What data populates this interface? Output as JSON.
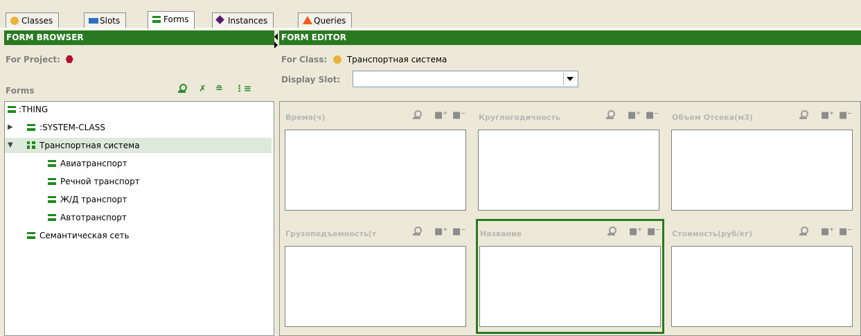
{
  "tabs": [
    {
      "label": "Classes",
      "icon": "class-icon",
      "active": false
    },
    {
      "label": "Slots",
      "icon": "slot-icon",
      "active": false
    },
    {
      "label": "Forms",
      "icon": "form-icon",
      "active": true
    },
    {
      "label": "Instances",
      "icon": "instance-icon",
      "active": false
    },
    {
      "label": "Queries",
      "icon": "query-icon",
      "active": false
    }
  ],
  "form_browser": {
    "header": "FORM BROWSER",
    "for_project_label": "For Project:",
    "forms_label": "Forms",
    "tree": [
      {
        "label": ":THING"
      },
      {
        "label": ":SYSTEM-CLASS"
      },
      {
        "label": "Транспортная система"
      },
      {
        "label": "Авиатранспорт"
      },
      {
        "label": "Речной транспорт"
      },
      {
        "label": "Ж/Д транспорт"
      },
      {
        "label": "Автотранспорт"
      },
      {
        "label": "Семантическая сеть"
      }
    ]
  },
  "form_editor": {
    "header": "FORM EDITOR",
    "for_class_label": "For Class:",
    "class_name": "Транспортная система",
    "display_slot_label": "Display Slot:",
    "display_slot_value": "",
    "widgets": [
      {
        "label": "Время(ч)"
      },
      {
        "label": "Круглогодичность"
      },
      {
        "label": "Объем Отсека(м3)"
      },
      {
        "label": "Грузоподъемность(т"
      },
      {
        "label": "Название"
      },
      {
        "label": "Стоимость(руб/кг)"
      }
    ]
  },
  "colors": {
    "header_green": "#287a21",
    "selection_outline": "#287a21",
    "class_icon": "#e8b33a",
    "project_icon": "#b50d2d"
  }
}
